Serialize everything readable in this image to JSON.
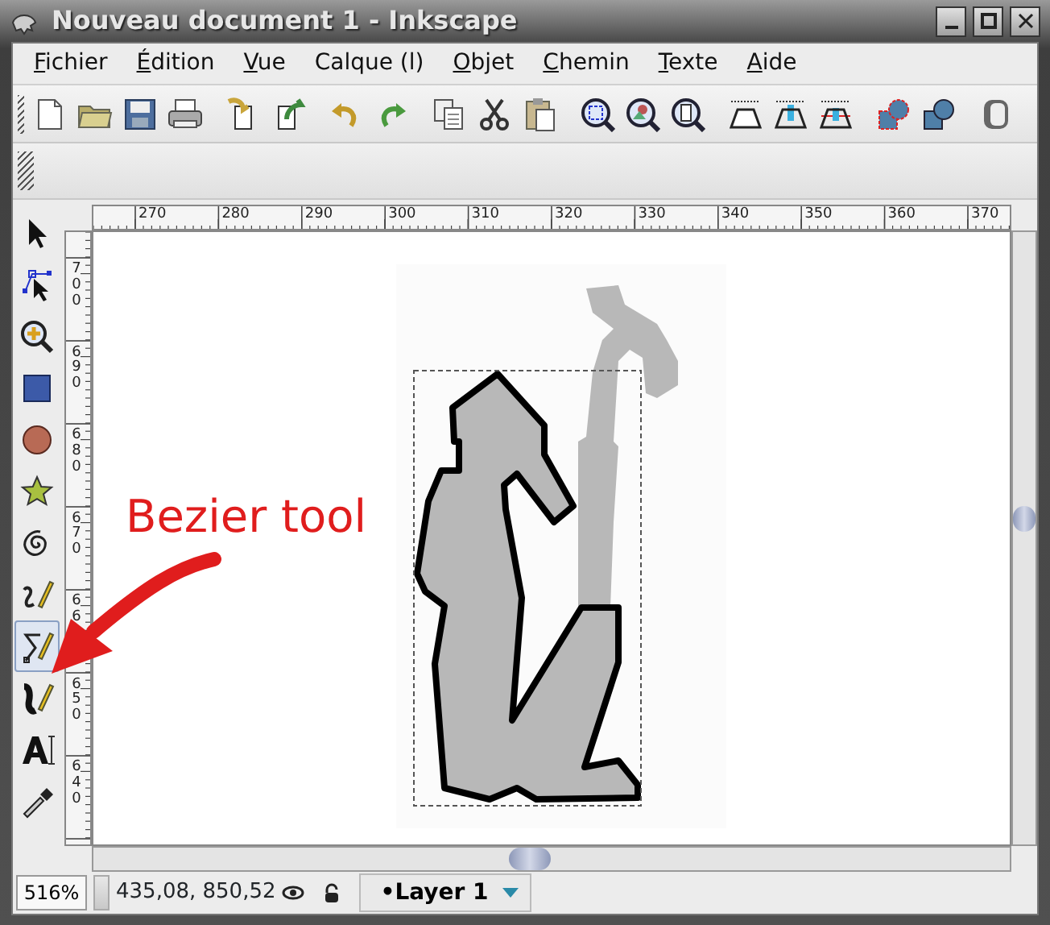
{
  "window": {
    "title": "Nouveau document 1 - Inkscape"
  },
  "menu": [
    {
      "label": "Fichier",
      "mnemonic": true
    },
    {
      "label": "Édition",
      "mnemonic": true
    },
    {
      "label": "Vue",
      "mnemonic": true
    },
    {
      "label": "Calque (l)",
      "mnemonic": false
    },
    {
      "label": "Objet",
      "mnemonic": true
    },
    {
      "label": "Chemin",
      "mnemonic": true
    },
    {
      "label": "Texte",
      "mnemonic": true
    },
    {
      "label": "Aide",
      "mnemonic": true
    }
  ],
  "toolbar": {
    "groups": [
      [
        {
          "kind": "new"
        },
        {
          "kind": "open"
        },
        {
          "kind": "save"
        },
        {
          "kind": "print"
        }
      ],
      [
        {
          "kind": "import"
        },
        {
          "kind": "export"
        }
      ],
      [
        {
          "kind": "undo"
        },
        {
          "kind": "redo"
        }
      ],
      [
        {
          "kind": "copy"
        },
        {
          "kind": "cut"
        },
        {
          "kind": "paste"
        }
      ],
      [
        {
          "kind": "zoom-selection"
        },
        {
          "kind": "zoom-drawing"
        },
        {
          "kind": "zoom-page"
        }
      ],
      [
        {
          "kind": "align-a"
        },
        {
          "kind": "align-b"
        },
        {
          "kind": "align-c"
        }
      ],
      [
        {
          "kind": "node-a"
        },
        {
          "kind": "node-b"
        }
      ],
      [
        {
          "kind": "gradient"
        }
      ]
    ]
  },
  "tools": [
    {
      "kind": "selector",
      "selected": false
    },
    {
      "kind": "node",
      "selected": false
    },
    {
      "kind": "zoom",
      "selected": false
    },
    {
      "kind": "rectangle",
      "selected": false
    },
    {
      "kind": "ellipse",
      "selected": false
    },
    {
      "kind": "star",
      "selected": false
    },
    {
      "kind": "spiral",
      "selected": false
    },
    {
      "kind": "pencil",
      "selected": false
    },
    {
      "kind": "bezier",
      "selected": true
    },
    {
      "kind": "calligraphy",
      "selected": false
    },
    {
      "kind": "text",
      "selected": false
    },
    {
      "kind": "dropper",
      "selected": false
    }
  ],
  "rulers": {
    "horizontal": [
      "270",
      "280",
      "290",
      "300",
      "310",
      "320",
      "330",
      "340",
      "350",
      "360",
      "370"
    ],
    "vertical": [
      "700",
      "690",
      "680",
      "670",
      "66",
      "650",
      "640"
    ]
  },
  "annotation": {
    "text": "Bezier tool"
  },
  "status_bar": {
    "zoom": "516%",
    "coordinates": "435,08, 850,52",
    "layer": "•Layer 1"
  }
}
